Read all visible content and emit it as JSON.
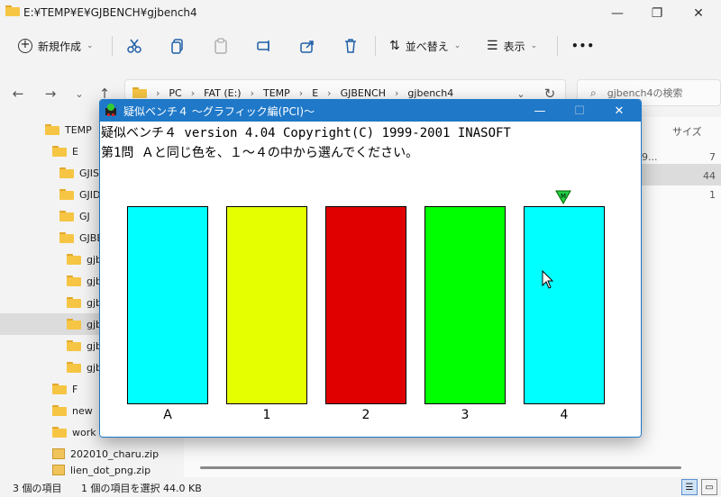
{
  "explorer": {
    "title": "E:¥TEMP¥E¥GJBENCH¥gjbench4",
    "toolbar": {
      "new_label": "新規作成",
      "sort_label": "並べ替え",
      "view_label": "表示",
      "more_label": "•••"
    },
    "breadcrumb": [
      "PC",
      "FAT (E:)",
      "TEMP",
      "E",
      "GJBENCH",
      "gjbench4"
    ],
    "search_placeholder": "gjbench4の検索",
    "tree": [
      {
        "label": "TEMP",
        "type": "folder"
      },
      {
        "label": "E",
        "type": "folder"
      },
      {
        "label": "GJIS",
        "type": "folder"
      },
      {
        "label": "GJID",
        "type": "folder"
      },
      {
        "label": "GJ",
        "type": "folder"
      },
      {
        "label": "GJBE",
        "type": "folder"
      },
      {
        "label": "gjb",
        "type": "folder"
      },
      {
        "label": "gjb",
        "type": "folder"
      },
      {
        "label": "gjb",
        "type": "folder"
      },
      {
        "label": "gjb",
        "type": "folder",
        "selected": true
      },
      {
        "label": "gjb",
        "type": "folder"
      },
      {
        "label": "gjb",
        "type": "folder"
      },
      {
        "label": "F",
        "type": "folder"
      },
      {
        "label": "new",
        "type": "folder"
      },
      {
        "label": "work",
        "type": "folder"
      },
      {
        "label": "202010_charu.zip",
        "type": "zip"
      },
      {
        "label": "lien_dot_png.zip",
        "type": "zip"
      }
    ],
    "column_size_header": "サイズ",
    "row_values": [
      "7",
      "44",
      "1"
    ],
    "row_fragment": "9...",
    "status_count": "3 個の項目",
    "status_selected": "1 個の項目を選択  44.0 KB"
  },
  "dialog": {
    "title": "疑似ベンチ４ 〜グラフィック編(PCI)〜",
    "header_line": "疑似ベンチ４ version 4.04  Copyright(C) 1999-2001 INASOFT",
    "question_line": "第1問  Ａと同じ色を、１〜４の中から選んでください。",
    "marker_text": "M",
    "swatches": [
      {
        "label": "A",
        "color": "#00ffff"
      },
      {
        "label": "1",
        "color": "#e5ff00"
      },
      {
        "label": "2",
        "color": "#e00000"
      },
      {
        "label": "3",
        "color": "#00ff00"
      },
      {
        "label": "4",
        "color": "#00ffff"
      }
    ],
    "marker_color": "#22cc44"
  }
}
